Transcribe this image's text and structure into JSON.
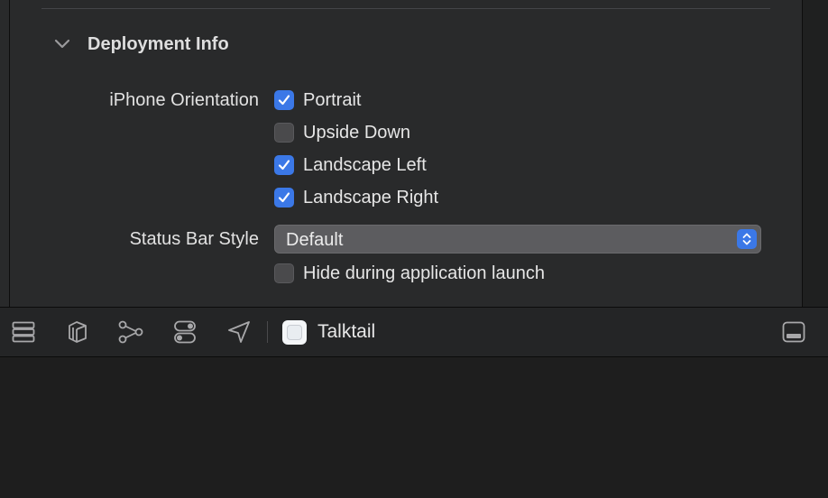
{
  "deployment": {
    "section_title": "Deployment Info",
    "orientation_label": "iPhone Orientation",
    "orientations": [
      {
        "label": "Portrait",
        "checked": true
      },
      {
        "label": "Upside Down",
        "checked": false
      },
      {
        "label": "Landscape Left",
        "checked": true
      },
      {
        "label": "Landscape Right",
        "checked": true
      }
    ],
    "status_bar_label": "Status Bar Style",
    "status_bar_value": "Default",
    "hide_launch_label": "Hide during application launch",
    "hide_launch_checked": false
  },
  "toolbar": {
    "icons": [
      "list-icon",
      "cube-stack-icon",
      "branch-icon",
      "toggle-icon",
      "location-arrow-icon"
    ],
    "target_name": "Talktail",
    "right_icon": "panel-toggle-icon"
  },
  "colors": {
    "accent": "#3b78e7",
    "panel_bg": "#292a2b",
    "toolbar_bg": "#242526",
    "bottom_bg": "#1e1e1e"
  }
}
